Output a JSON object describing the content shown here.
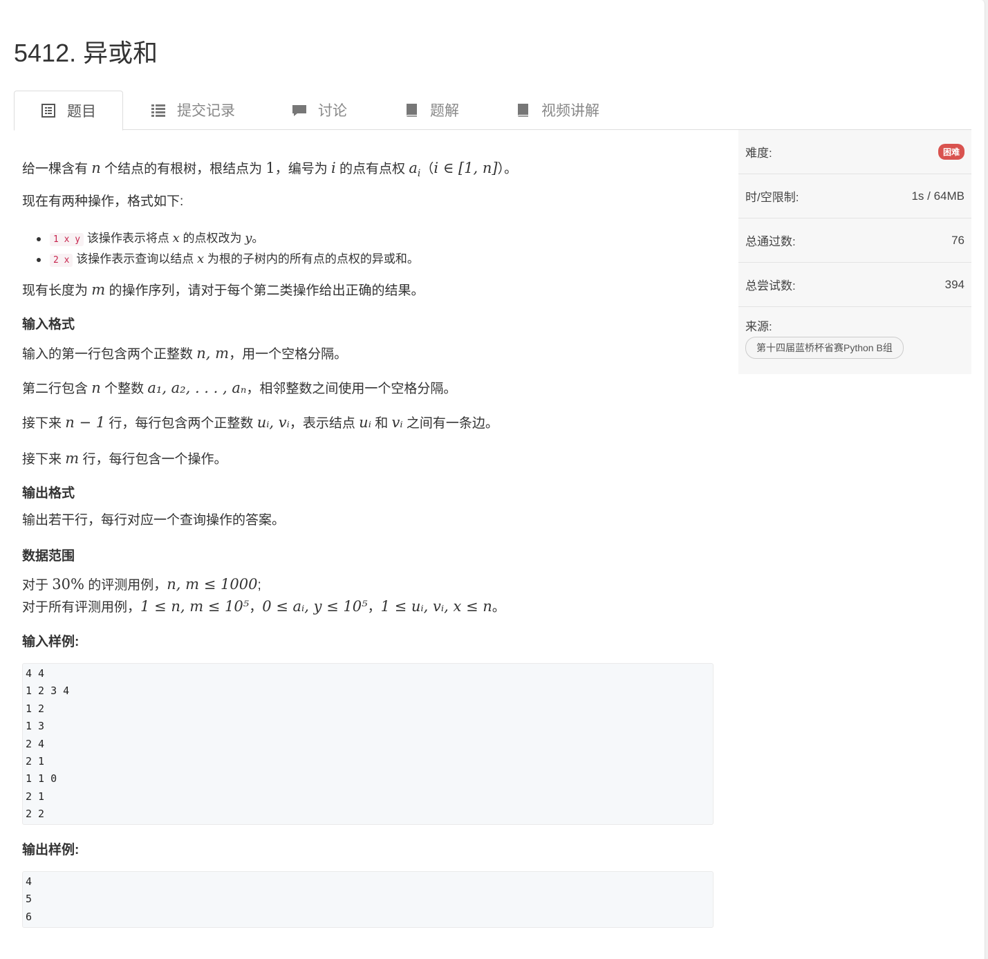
{
  "problem": {
    "title": "5412. 异或和"
  },
  "tabs": [
    {
      "label": "题目",
      "icon": "document-icon"
    },
    {
      "label": "提交记录",
      "icon": "list-icon"
    },
    {
      "label": "讨论",
      "icon": "comment-icon"
    },
    {
      "label": "题解",
      "icon": "book-icon"
    },
    {
      "label": "视频讲解",
      "icon": "book-icon"
    }
  ],
  "statement": {
    "p1": {
      "a": "给一棵含有 ",
      "b": "n",
      "c": " 个结点的有根树，根结点为 ",
      "d": "1",
      "e": "，编号为 ",
      "f": "i",
      "g": " 的点有点权 ",
      "h": "a",
      "hs": "i",
      "i": "（",
      "j": "i ∈ [1, n]",
      "k": "）。"
    },
    "p2": "现在有两种操作，格式如下:",
    "op1": {
      "code": "1 x y",
      "a": " 该操作表示将点 ",
      "b": "x",
      "c": " 的点权改为 ",
      "d": "y",
      "e": "。"
    },
    "op2": {
      "code": "2 x",
      "a": " 该操作表示查询以结点 ",
      "b": "x",
      "c": " 为根的子树内的所有点的点权的异或和。"
    },
    "p3": {
      "a": "现有长度为 ",
      "b": "m",
      "c": " 的操作序列，请对于每个第二类操作给出正确的结果。"
    }
  },
  "input_format": {
    "heading": "输入格式",
    "l1": {
      "a": "输入的第一行包含两个正整数 ",
      "b": "n, m",
      "c": "，用一个空格分隔。"
    },
    "l2": {
      "a": "第二行包含 ",
      "b": "n",
      "c": " 个整数 ",
      "d": "a₁, a₂, . . . , aₙ",
      "e": "，相邻整数之间使用一个空格分隔。"
    },
    "l3": {
      "a": "接下来 ",
      "b": "n − 1",
      "c": " 行，每行包含两个正整数 ",
      "d": "uᵢ, vᵢ",
      "e": "，表示结点 ",
      "f": "uᵢ",
      "g": " 和 ",
      "h": "vᵢ",
      "i": " 之间有一条边。"
    },
    "l4": {
      "a": "接下来 ",
      "b": "m",
      "c": " 行，每行包含一个操作。"
    }
  },
  "output_format": {
    "heading": "输出格式",
    "text": "输出若干行，每行对应一个查询操作的答案。"
  },
  "data_range": {
    "heading": "数据范围",
    "l1": {
      "a": "对于 ",
      "b": "30%",
      "c": " 的评测用例，",
      "d": "n, m ≤ 1000",
      "e": ";"
    },
    "l2": {
      "a": "对于所有评测用例，",
      "b": "1 ≤ n, m ≤ 10⁵",
      "c": "，",
      "d": "0 ≤ aᵢ, y ≤ 10⁵",
      "e": "，",
      "f": "1 ≤ uᵢ, vᵢ, x ≤ n",
      "g": "。"
    }
  },
  "sample_input": {
    "heading": "输入样例:",
    "text": "4 4\n1 2 3 4\n1 2\n1 3\n2 4\n2 1\n1 1 0\n2 1\n2 2"
  },
  "sample_output": {
    "heading": "输出样例:",
    "text": "4\n5\n6"
  },
  "sidebar": {
    "difficulty_label": "难度:",
    "difficulty_value": "困难",
    "difficulty_color": "#d9534f",
    "limit_label": "时/空限制:",
    "limit_value": "1s / 64MB",
    "passed_label": "总通过数:",
    "passed_value": "76",
    "tried_label": "总尝试数:",
    "tried_value": "394",
    "source_label": "来源:",
    "source_value": "第十四届蓝桥杯省赛Python B组"
  }
}
